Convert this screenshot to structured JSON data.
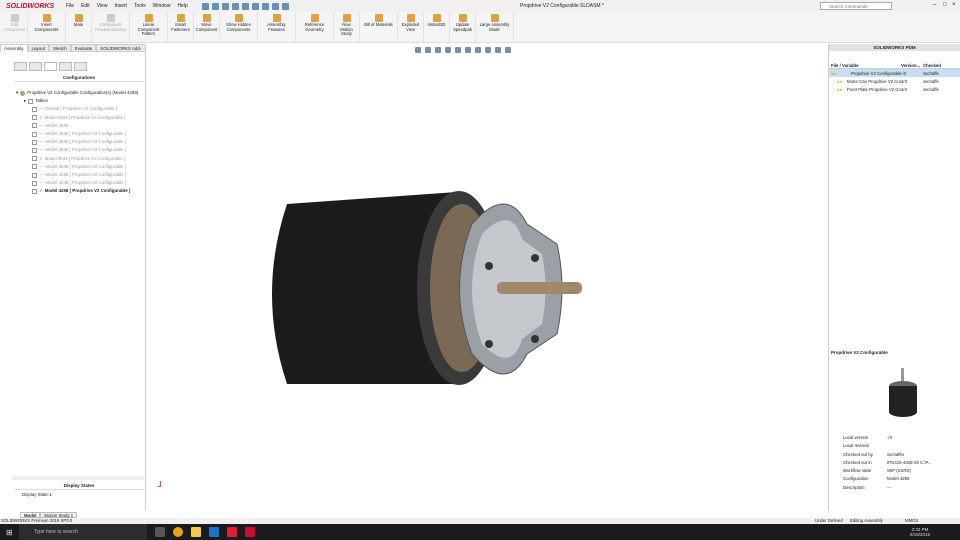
{
  "app": {
    "logo": "SOLIDWORKS",
    "title": "Propdrive V2 Configurable.SLDASM *",
    "search_placeholder": "Search Commands"
  },
  "menu": [
    "File",
    "Edit",
    "View",
    "Insert",
    "Tools",
    "Window",
    "Help"
  ],
  "commands": [
    {
      "label": "Edit Component",
      "disabled": true
    },
    {
      "label": "Insert Components"
    },
    {
      "label": "Mate"
    },
    {
      "label": "Component Preview Window",
      "disabled": true
    },
    {
      "label": "Linear Component Pattern"
    },
    {
      "label": "Smart Fasteners"
    },
    {
      "label": "Move Component"
    },
    {
      "label": "Show Hidden Components"
    },
    {
      "label": "Assembly Features"
    },
    {
      "label": "Reference Geometry"
    },
    {
      "label": "New Motion Study"
    },
    {
      "label": "Bill of Materials"
    },
    {
      "label": "Exploded View"
    },
    {
      "label": "Instant3D"
    },
    {
      "label": "Update Speedpak"
    },
    {
      "label": "Large Assembly Mode"
    }
  ],
  "tabs": [
    "Assembly",
    "Layout",
    "Sketch",
    "Evaluate",
    "SOLIDWORKS Add-Ins"
  ],
  "left": {
    "header": "Configurations",
    "root": "Propdrive V2 Configurable Configuration(s)  (Model 4258)",
    "tables": "Tables",
    "configs": [
      "Default [ Propdrive V2 Configurable ]",
      "Model 2826 [ Propdrive V2 Configurable ]",
      "Model 2830",
      "Model 2836 [ Propdrive V2 Configurable ]",
      "Model 3530 [ Propdrive V2 Configurable ]",
      "Model 3536 [ Propdrive V2 Configurable ]",
      "Model 3542 [ Propdrive V2 Configurable ]",
      "Model 3548 [ Propdrive V2 Configurable ]",
      "Model 4238 [ Propdrive V2 Configurable ]",
      "Model 4248 [ Propdrive V2 Configurable ]",
      "Model 4258 [ Propdrive V2 Configurable ]"
    ],
    "display_states_header": "Display States",
    "display_state": "Display State-1"
  },
  "pdm": {
    "title": "SOLIDWORKS PDM",
    "columns": [
      "File / Variable",
      "Version...",
      "Checked"
    ],
    "rows": [
      {
        "name": "Propdrive V2 Configurable (...",
        "version": "-/3",
        "checked": "sschaffe"
      },
      {
        "name": "Motor Can Propdrive V2 Confi...",
        "version": "3/3",
        "checked": "sschaffe"
      },
      {
        "name": "Front Plate Propdrive V2 Confi...",
        "version": "4/4",
        "checked": "sschaffe"
      }
    ],
    "preview_title": "Propdrive V2 Configurable",
    "props": [
      {
        "k": "Local version",
        "v": "-/3"
      },
      {
        "k": "Local revision",
        "v": ""
      },
      {
        "k": "Checked out by",
        "v": "sschaffer"
      },
      {
        "k": "Checked out in",
        "v": "IPG415-4328-29  C:\\P..."
      },
      {
        "k": "Workflow state",
        "v": "WIP (SSRD)"
      },
      {
        "k": "Configuration",
        "v": "Model 4258"
      },
      {
        "k": "Description",
        "v": "---"
      }
    ]
  },
  "model_tabs": [
    "Model",
    "Motion Study 1"
  ],
  "status": {
    "left": "SOLIDWORKS Premium 2019 SP3.0",
    "defined": "Under Defined",
    "mode": "Editing Assembly",
    "units": "MMGS"
  },
  "taskbar": {
    "search": "Type here to search",
    "time": "3:33 PM",
    "date": "8/19/2019"
  }
}
